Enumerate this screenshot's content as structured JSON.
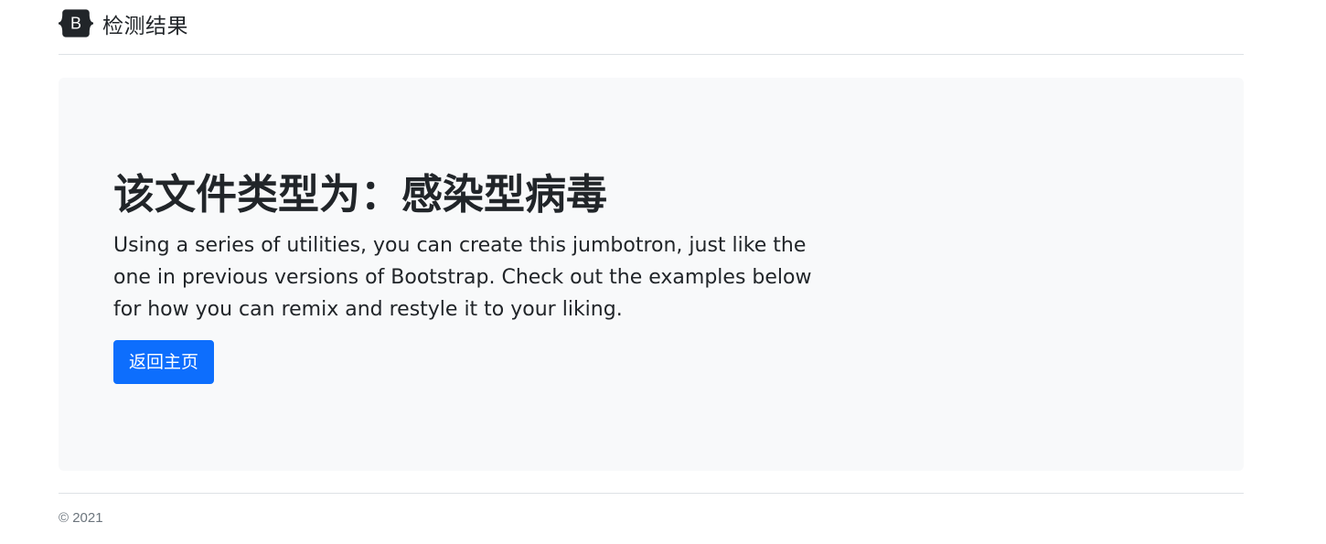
{
  "header": {
    "brand_letter": "B",
    "brand_text": "检测结果"
  },
  "jumbotron": {
    "title": "该文件类型为：感染型病毒",
    "lead": "Using a series of utilities, you can create this jumbotron, just like the one in previous versions of Bootstrap. Check out the examples below for how you can remix and restyle it to your liking.",
    "button_label": "返回主页"
  },
  "footer": {
    "copyright": "© 2021"
  },
  "colors": {
    "primary": "#0d6efd",
    "jumbotron_bg": "#f8f9fa",
    "border": "#dee2e6",
    "text": "#212529",
    "muted": "#6c757d"
  },
  "icons": {
    "brand": "bootstrap-logo-icon"
  }
}
